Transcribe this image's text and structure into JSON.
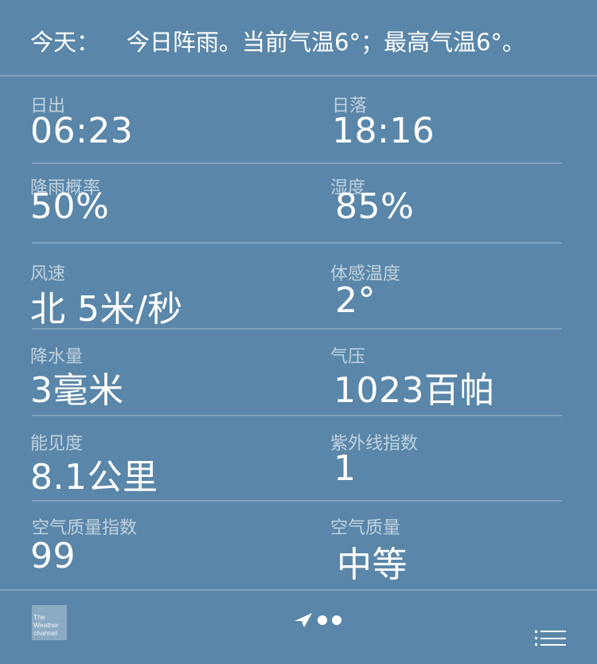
{
  "summary": {
    "label": "今天：",
    "text": "今日阵雨。当前气温6°；最高气温6°。"
  },
  "details": [
    {
      "key": "sunrise",
      "label": "日出",
      "value": "06:23"
    },
    {
      "key": "sunset",
      "label": "日落",
      "value": "18:16"
    },
    {
      "key": "chance-of-rain",
      "label": "降雨概率",
      "value": "50%"
    },
    {
      "key": "humidity",
      "label": "湿度",
      "value": "85%"
    },
    {
      "key": "wind",
      "label": "风速",
      "value": "北 5米/秒"
    },
    {
      "key": "feels-like",
      "label": "体感温度",
      "value": "2°"
    },
    {
      "key": "precipitation",
      "label": "降水量",
      "value": "3毫米"
    },
    {
      "key": "pressure",
      "label": "气压",
      "value": "1023百帕"
    },
    {
      "key": "visibility",
      "label": "能见度",
      "value": "8.1公里"
    },
    {
      "key": "uv-index",
      "label": "紫外线指数",
      "value": "1"
    },
    {
      "key": "aqi",
      "label": "空气质量指数",
      "value": "99"
    },
    {
      "key": "air-quality",
      "label": "空气质量",
      "value": "中等"
    }
  ],
  "footer": {
    "logo_text": "The Weather channel",
    "logo_icon": "weather-channel-logo",
    "location_icon": "location-arrow-icon",
    "page_count": 2,
    "list_icon": "list-icon"
  },
  "colors": {
    "background": "#5a87a9",
    "text": "#ffffff",
    "label": "#c8d8e5"
  }
}
